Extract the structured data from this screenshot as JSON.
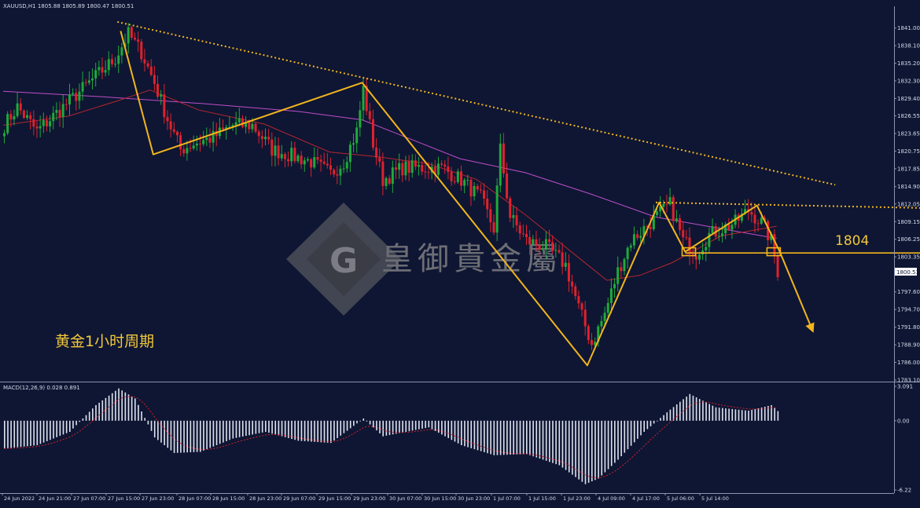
{
  "header": {
    "symbol_timeframe": "XAUUSD,H1",
    "ohlc": "1805.88 1805.89 1800.47 1800.51"
  },
  "caption": "黄金1小时周期",
  "watermark": {
    "brand_text": "皇御貴金屬",
    "logo_letter": "G"
  },
  "level_label": "1804",
  "current_price": "1800.51",
  "macd": {
    "header": "MACD(12,26,9) 0.028 0.891",
    "axis_labels": [
      "3.091",
      "0.00",
      "-6.22"
    ]
  },
  "colors": {
    "background": "#0e1633",
    "bull": "#1faa3a",
    "bear": "#e0212e",
    "annotation": "#f3b51d",
    "ma_slow": "#c14dc8",
    "ma_fast": "#b3262f",
    "macd_bar": "#dfe3ee"
  },
  "chart_data": {
    "type": "candlestick",
    "price_axis_labels": [
      "1841.00",
      "1838.10",
      "1835.20",
      "1832.30",
      "1829.40",
      "1826.55",
      "1823.65",
      "1820.75",
      "1817.85",
      "1814.90",
      "1812.05",
      "1809.15",
      "1806.25",
      "1803.35",
      "1800.51",
      "1797.60",
      "1794.70",
      "1791.80",
      "1788.90",
      "1786.00",
      "1783.10"
    ],
    "time_axis_labels": [
      "24 Jun 2022",
      "24 Jun 21:00",
      "27 Jun 07:00",
      "27 Jun 15:00",
      "27 Jun 23:00",
      "28 Jun 07:00",
      "28 Jun 15:00",
      "28 Jun 23:00",
      "29 Jun 07:00",
      "29 Jun 15:00",
      "29 Jun 23:00",
      "30 Jun 07:00",
      "30 Jun 15:00",
      "30 Jun 23:00",
      "1 Jul 07:00",
      "1 Jul 15:00",
      "1 Jul 23:00",
      "4 Jul 09:00",
      "4 Jul 17:00",
      "5 Jul 06:00",
      "5 Jul 14:00"
    ],
    "ylim": [
      1783.1,
      1842.5
    ],
    "price_anchors": [
      [
        0,
        1825
      ],
      [
        4,
        1828
      ],
      [
        10,
        1824
      ],
      [
        16,
        1827
      ],
      [
        22,
        1830
      ],
      [
        28,
        1833
      ],
      [
        34,
        1836
      ],
      [
        38,
        1840
      ],
      [
        42,
        1837
      ],
      [
        46,
        1832
      ],
      [
        50,
        1826
      ],
      [
        54,
        1821
      ],
      [
        58,
        1822
      ],
      [
        64,
        1823
      ],
      [
        70,
        1825
      ],
      [
        76,
        1825
      ],
      [
        82,
        1821
      ],
      [
        88,
        1820
      ],
      [
        94,
        1819
      ],
      [
        100,
        1817
      ],
      [
        104,
        1819
      ],
      [
        108,
        1824
      ],
      [
        110,
        1831
      ],
      [
        113,
        1822
      ],
      [
        116,
        1816
      ],
      [
        122,
        1818
      ],
      [
        128,
        1818
      ],
      [
        134,
        1818
      ],
      [
        140,
        1816
      ],
      [
        146,
        1813
      ],
      [
        150,
        1808
      ],
      [
        152,
        1821
      ],
      [
        155,
        1810
      ],
      [
        160,
        1806
      ],
      [
        166,
        1805
      ],
      [
        172,
        1802
      ],
      [
        176,
        1795
      ],
      [
        180,
        1789
      ],
      [
        184,
        1794
      ],
      [
        188,
        1801
      ],
      [
        192,
        1806
      ],
      [
        196,
        1808
      ],
      [
        200,
        1810
      ],
      [
        204,
        1812
      ],
      [
        208,
        1806
      ],
      [
        212,
        1804
      ],
      [
        216,
        1807
      ],
      [
        220,
        1808
      ],
      [
        224,
        1809
      ],
      [
        228,
        1811
      ],
      [
        232,
        1809
      ],
      [
        235,
        1806
      ],
      [
        237,
        1801
      ]
    ],
    "series": [
      {
        "name": "",
        "role": "ma_slow",
        "points": [
          [
            0,
            1830.6
          ],
          [
            30,
            1829.7
          ],
          [
            60,
            1828.6
          ],
          [
            90,
            1827.3
          ],
          [
            110,
            1825.9
          ],
          [
            140,
            1819.5
          ],
          [
            160,
            1817.2
          ],
          [
            180,
            1813.7
          ],
          [
            200,
            1809.9
          ],
          [
            220,
            1808.0
          ],
          [
            237,
            1806.4
          ]
        ]
      },
      {
        "name": "",
        "role": "ma_fast",
        "points": [
          [
            0,
            1825
          ],
          [
            20,
            1826.5
          ],
          [
            35,
            1829
          ],
          [
            45,
            1830.8
          ],
          [
            60,
            1827.5
          ],
          [
            80,
            1825.2
          ],
          [
            100,
            1820.6
          ],
          [
            115,
            1819.8
          ],
          [
            130,
            1818.7
          ],
          [
            145,
            1816.1
          ],
          [
            160,
            1810.3
          ],
          [
            175,
            1803.8
          ],
          [
            185,
            1799.5
          ],
          [
            195,
            1800.3
          ],
          [
            205,
            1802.4
          ],
          [
            220,
            1806.8
          ],
          [
            237,
            1808.4
          ]
        ]
      }
    ],
    "annotations": {
      "resistance_trend": [
        [
          35,
          1842.0
        ],
        [
          255,
          1815.2
        ]
      ],
      "resistance_flat": [
        [
          200,
          1812.3
        ],
        [
          290,
          1811.3
        ]
      ],
      "support_level": {
        "value": 1804,
        "from": 209,
        "to": 290
      },
      "zigzag": [
        [
          36,
          1840.5
        ],
        [
          46,
          1820.2
        ],
        [
          110,
          1832.0
        ],
        [
          179,
          1785.5
        ],
        [
          201,
          1812.3
        ],
        [
          209,
          1804.2
        ],
        [
          231,
          1811.8
        ],
        [
          238,
          1804.2
        ],
        [
          248,
          1791.3
        ]
      ],
      "marker_boxes": [
        [
          210,
          1804.2
        ],
        [
          236,
          1804.2
        ]
      ]
    },
    "macd_range": [
      -6.22,
      3.091
    ]
  }
}
